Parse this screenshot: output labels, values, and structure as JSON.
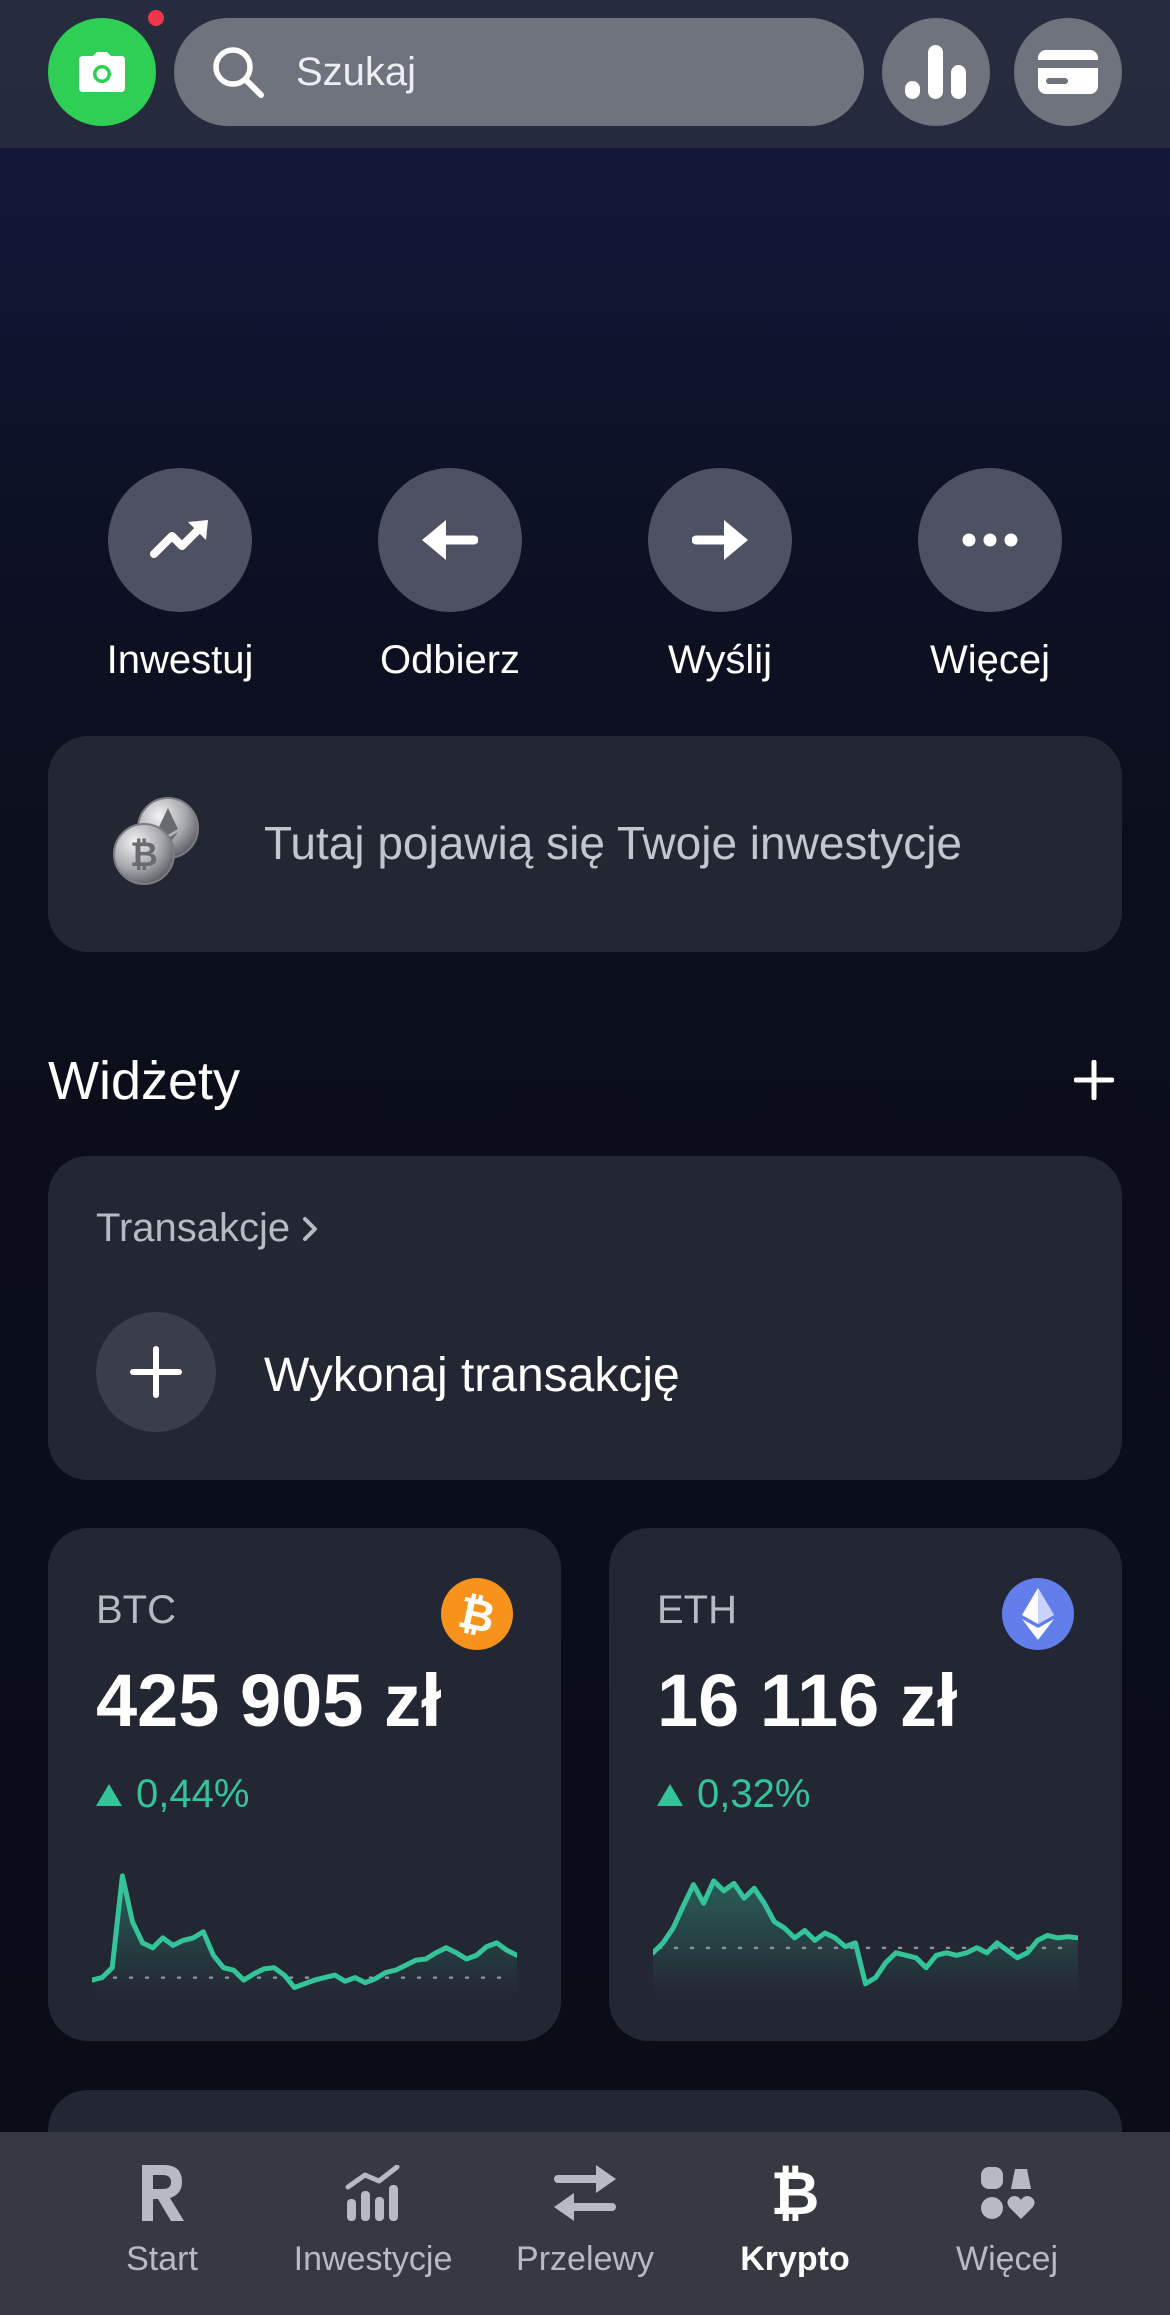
{
  "header": {
    "search_placeholder": "Szukaj",
    "icons": [
      "camera-icon",
      "search-icon",
      "analytics-icon",
      "card-icon"
    ],
    "accent_green": "#2fcf55",
    "notification_dot_color": "#f0374a"
  },
  "actions": [
    {
      "label": "Inwestuj",
      "icon": "trend-up-icon"
    },
    {
      "label": "Odbierz",
      "icon": "arrow-left-icon"
    },
    {
      "label": "Wyślij",
      "icon": "arrow-right-icon"
    },
    {
      "label": "Więcej",
      "icon": "more-dots-icon"
    }
  ],
  "investments_banner": {
    "text": "Tutaj pojawią się Twoje inwestycje",
    "icon": "coins-icon"
  },
  "widgets": {
    "title": "Widżety",
    "transactions": {
      "title": "Transakcje",
      "action_label": "Wykonaj transakcję"
    },
    "coins": [
      {
        "symbol": "BTC",
        "price": "425 905 zł",
        "change": "0,44%",
        "logo_color": "#f7931a"
      },
      {
        "symbol": "ETH",
        "price": "16 116 zł",
        "change": "0,32%",
        "logo_color": "#627eea"
      }
    ],
    "positive_color": "#35c49a"
  },
  "chart_data": [
    {
      "type": "line",
      "series": [
        {
          "values": [
            0.08,
            0.1,
            0.18,
            0.92,
            0.55,
            0.38,
            0.34,
            0.42,
            0.36,
            0.4,
            0.42,
            0.47,
            0.28,
            0.18,
            0.16,
            0.08,
            0.13,
            0.17,
            0.18,
            0.12,
            0.02,
            0.05,
            0.08,
            0.1,
            0.12,
            0.07,
            0.1,
            0.06,
            0.09,
            0.14,
            0.16,
            0.2,
            0.24,
            0.25,
            0.3,
            0.34,
            0.3,
            0.25,
            0.28,
            0.35,
            0.38,
            0.32,
            0.28
          ]
        }
      ],
      "reference_line": 0.1
    },
    {
      "type": "line",
      "series": [
        {
          "values": [
            0.3,
            0.38,
            0.5,
            0.68,
            0.85,
            0.7,
            0.88,
            0.8,
            0.86,
            0.74,
            0.82,
            0.7,
            0.55,
            0.5,
            0.42,
            0.48,
            0.4,
            0.46,
            0.42,
            0.35,
            0.38,
            0.05,
            0.1,
            0.22,
            0.3,
            0.28,
            0.26,
            0.18,
            0.28,
            0.3,
            0.28,
            0.3,
            0.34,
            0.3,
            0.38,
            0.32,
            0.26,
            0.3,
            0.4,
            0.44,
            0.42,
            0.43,
            0.42
          ]
        }
      ],
      "reference_line": 0.34
    }
  ],
  "bottom_nav": [
    {
      "label": "Start",
      "icon": "revolut-r-icon",
      "active": false
    },
    {
      "label": "Inwestycje",
      "icon": "investments-chart-icon",
      "active": false
    },
    {
      "label": "Przelewy",
      "icon": "transfer-arrows-icon",
      "active": false
    },
    {
      "label": "Krypto",
      "icon": "bitcoin-icon",
      "active": true
    },
    {
      "label": "Więcej",
      "icon": "more-grid-icon",
      "active": false
    }
  ]
}
